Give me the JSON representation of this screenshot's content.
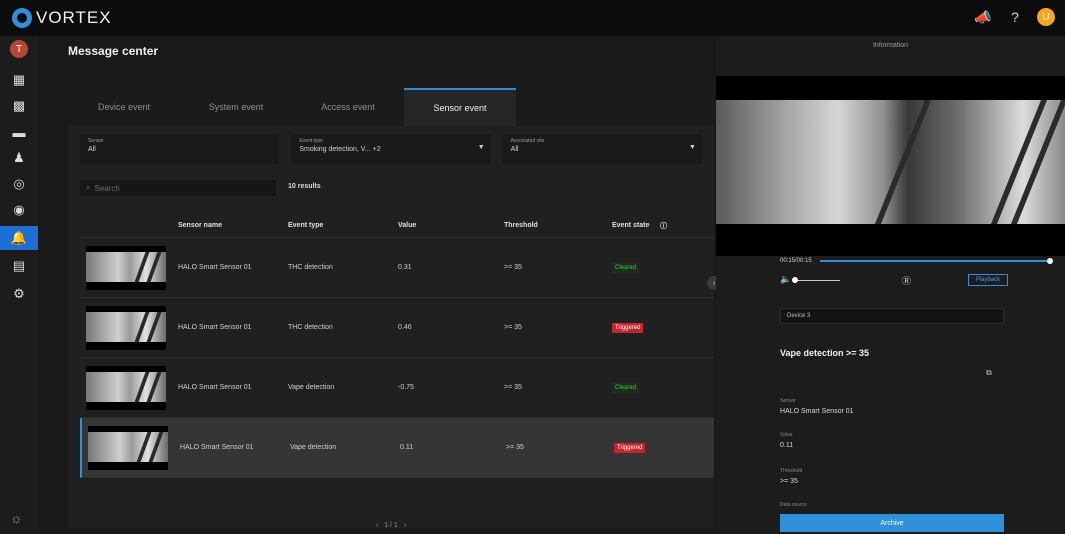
{
  "app": {
    "name": "VORTEX",
    "user_initial": "T",
    "account_initial": "U"
  },
  "colors": {
    "accent": "#2f8fd8",
    "sidebar_active": "#1f6ed4",
    "cleared": "#3acb4c",
    "triggered": "#c4262e"
  },
  "sidebar": {
    "items": [
      {
        "icon": "dashboard-icon",
        "glyph": "▦"
      },
      {
        "icon": "grid-icon",
        "glyph": "▩"
      },
      {
        "icon": "camera-icon",
        "glyph": "▬"
      },
      {
        "icon": "user-icon",
        "glyph": "♟"
      },
      {
        "icon": "target-icon",
        "glyph": "◎"
      },
      {
        "icon": "face-icon",
        "glyph": "◉"
      },
      {
        "icon": "bell-icon",
        "glyph": "🔔",
        "active": true
      },
      {
        "icon": "archive-icon",
        "glyph": "▤"
      },
      {
        "icon": "settings-icon",
        "glyph": "⚙"
      }
    ],
    "theme_glyph": "☼"
  },
  "main": {
    "title": "Message center",
    "tabs": [
      {
        "label": "Device event"
      },
      {
        "label": "System event"
      },
      {
        "label": "Access event"
      },
      {
        "label": "Sensor event",
        "active": true
      }
    ],
    "filters": [
      {
        "label": "Sensor",
        "value": "All"
      },
      {
        "label": "Event type",
        "value": "Smoking detection, V... +2"
      },
      {
        "label": "Associated site",
        "value": "All"
      }
    ],
    "search_placeholder": "Search",
    "results": "10 results",
    "columns": [
      "Sensor name",
      "Event type",
      "Value",
      "Threshold",
      "Event state"
    ],
    "rows": [
      {
        "sensor": "HALO Smart Sensor 01",
        "event": "THC detection",
        "value": "0.31",
        "threshold": ">= 35",
        "state": "Cleared"
      },
      {
        "sensor": "HALO Smart Sensor 01",
        "event": "THC detection",
        "value": "0.46",
        "threshold": ">= 35",
        "state": "Triggered"
      },
      {
        "sensor": "HALO Smart Sensor 01",
        "event": "Vape detection",
        "value": "-0.75",
        "threshold": ">= 35",
        "state": "Cleared"
      },
      {
        "sensor": "HALO Smart Sensor 01",
        "event": "Vape detection",
        "value": "0.11",
        "threshold": ">= 35",
        "state": "Triggered",
        "selected": true
      }
    ],
    "pager": {
      "prev": "‹",
      "text": "1 / 1",
      "next": "›"
    }
  },
  "info": {
    "title": "Information",
    "time": "00:15/00:15",
    "playback_label": "Playback",
    "device": "Device 3",
    "event_title": "Vape detection >= 35",
    "sensor_label": "Sensor",
    "sensor_value": "HALO Smart Sensor 01",
    "value_label": "Value",
    "value_value": "0.11",
    "threshold_label": "Threshold",
    "threshold_value": ">= 35",
    "data_source_label": "Data source",
    "archive_label": "Archive"
  }
}
